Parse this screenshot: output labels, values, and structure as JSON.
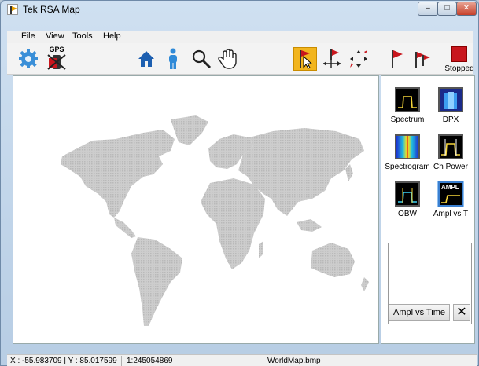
{
  "window": {
    "title": "Tek RSA Map"
  },
  "menu": [
    "File",
    "View",
    "Tools",
    "Help"
  ],
  "toolbar": {
    "gps_label": "GPS",
    "stopped_label": "Stopped",
    "icons": [
      "gear-icon",
      "gps-icon",
      "home-icon",
      "person-icon",
      "magnifier-icon",
      "hand-pan-icon",
      "select-flag-icon",
      "move-flag-icon",
      "spread-flag-icon",
      "flag-icon",
      "multi-flag-icon",
      "stop-icon"
    ],
    "active_tool": "select-flag-icon",
    "accent_color": "#f2b51e",
    "stop_color": "#c8161d"
  },
  "side_panel": {
    "tools": [
      {
        "label": "Spectrum",
        "icon": "spectrum-icon"
      },
      {
        "label": "DPX",
        "icon": "dpx-icon"
      },
      {
        "label": "Spectrogram",
        "icon": "spectrogram-icon"
      },
      {
        "label": "Ch Power",
        "icon": "ch-power-icon"
      },
      {
        "label": "OBW",
        "icon": "obw-icon"
      },
      {
        "label": "Ampl vs T",
        "icon": "ampl-vs-time-icon",
        "badge": "AMPL",
        "selected": true
      }
    ],
    "preview": {
      "label": "Ampl vs Time",
      "close": "✕"
    }
  },
  "map": {
    "land_color": "#c8c8c8"
  },
  "status": {
    "coords": "X : -55.983709 | Y : 85.017599",
    "scale": "1:245054869",
    "file": "WorldMap.bmp"
  }
}
